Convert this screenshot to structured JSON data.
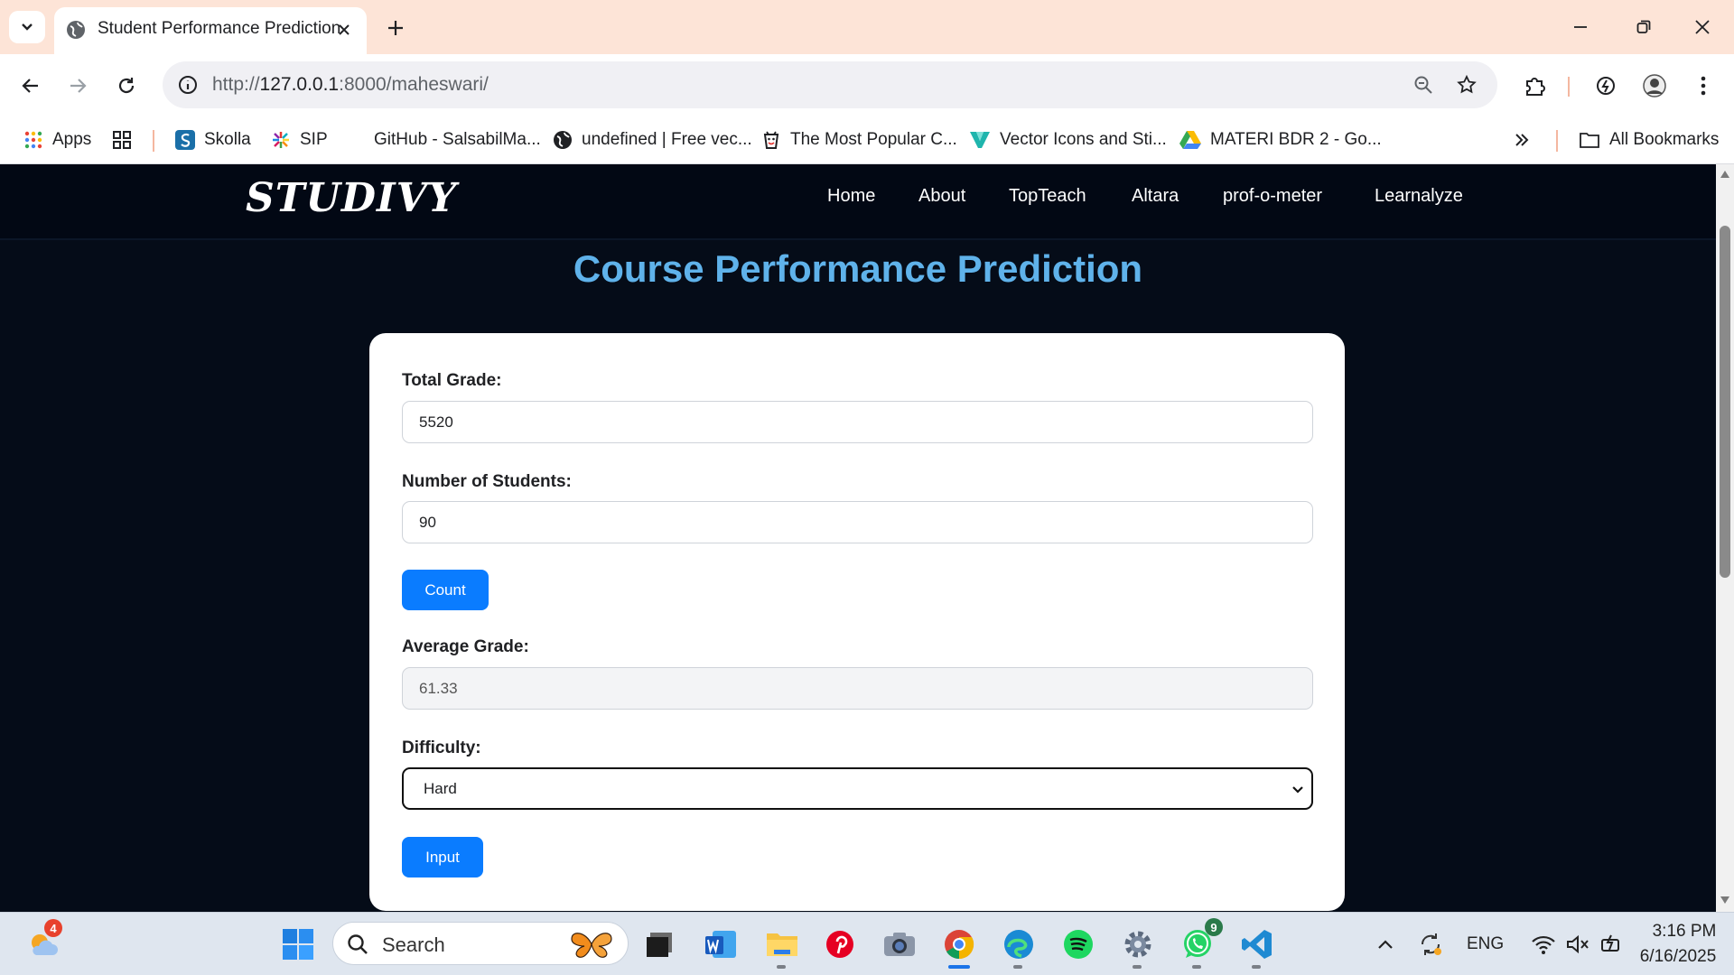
{
  "browser": {
    "tab_title": "Student Performance Prediction",
    "url_prefix": "http://",
    "url_host": "127.0.0.1",
    "url_rest": ":8000/maheswari/"
  },
  "bookmarks": {
    "items": [
      {
        "label": "Apps",
        "icon": "apps-grid-icon"
      },
      {
        "label": "",
        "icon": "tab-groups-icon"
      },
      {
        "label": "Skolla",
        "icon": "skolla-icon"
      },
      {
        "label": "SIP",
        "icon": "sip-icon"
      },
      {
        "label": "GitHub - SalsabilMa...",
        "icon": ""
      },
      {
        "label": "undefined | Free vec...",
        "icon": "globe-icon"
      },
      {
        "label": "The Most Popular C...",
        "icon": "cup-icon"
      },
      {
        "label": "Vector Icons and Sti...",
        "icon": "vector-icon"
      },
      {
        "label": "MATERI BDR 2 - Go...",
        "icon": "drive-icon"
      }
    ],
    "all_bookmarks": "All Bookmarks"
  },
  "site": {
    "logo": "STUDIVY",
    "nav": [
      "Home",
      "About",
      "TopTeach",
      "Altara",
      "prof-o-meter",
      "Learnalyze"
    ],
    "page_title": "Course Performance Prediction"
  },
  "form": {
    "total_grade_label": "Total Grade:",
    "total_grade_value": "5520",
    "students_label": "Number of Students:",
    "students_value": "90",
    "count_button": "Count",
    "average_label": "Average Grade:",
    "average_value": "61.33",
    "difficulty_label": "Difficulty:",
    "difficulty_value": "Hard",
    "input_button": "Input"
  },
  "taskbar": {
    "search_placeholder": "Search",
    "weather_badge": "4",
    "whatsapp_badge": "9",
    "language": "ENG",
    "time": "3:16 PM",
    "date": "6/16/2025"
  },
  "colors": {
    "page_bg": "#050c18",
    "title": "#5fb2ea",
    "button": "#0a7cff",
    "tab_strip": "#fde4d7"
  }
}
